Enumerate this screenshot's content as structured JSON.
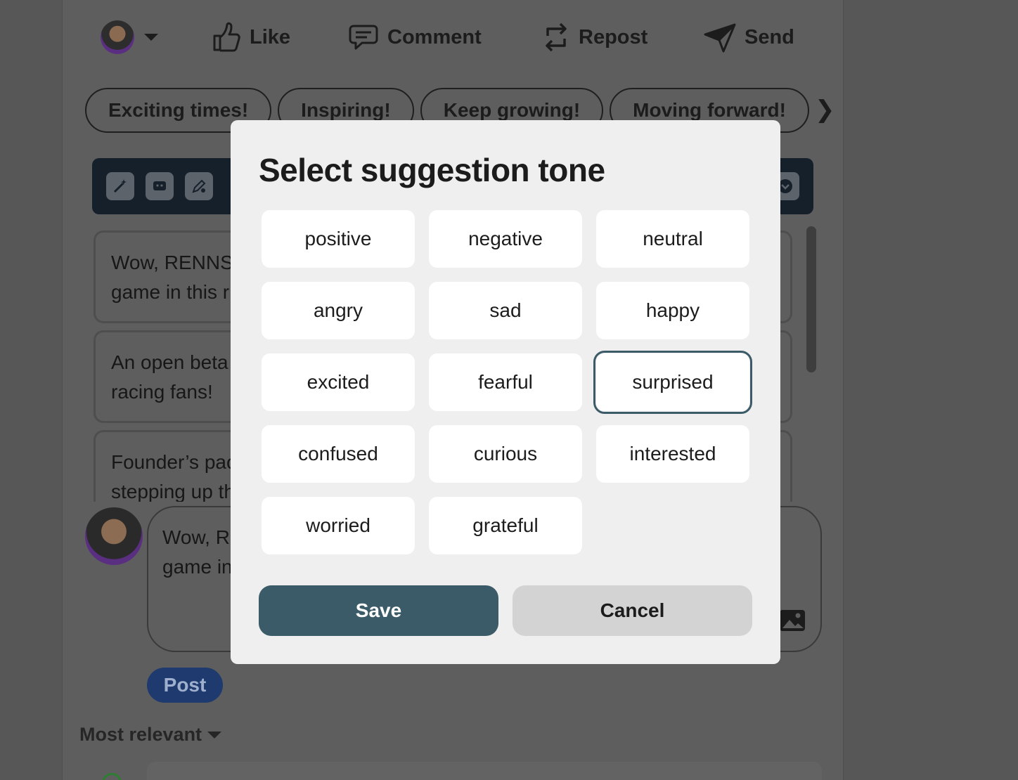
{
  "actions": {
    "like": "Like",
    "comment": "Comment",
    "repost": "Repost",
    "send": "Send"
  },
  "chips": [
    "Exciting times!",
    "Inspiring!",
    "Keep growing!",
    "Moving forward!"
  ],
  "chip_next_icon": "chevron-right-icon",
  "toolbar_icons": [
    "magic-wand-icon",
    "chat-bubble-icon",
    "pencil-settings-icon",
    "chevron-down-icon"
  ],
  "suggestions": [
    {
      "line1": "Wow, RENNSI",
      "line2": "game in this r"
    },
    {
      "line1": "An open beta",
      "line2": "racing fans!"
    },
    {
      "line1": "Founder’s pac",
      "line2": "stepping up th"
    }
  ],
  "comment_box": {
    "line1": "Wow, RI",
    "line2": "game in"
  },
  "post_button": "Post",
  "sort_label": "Most relevant",
  "modal": {
    "title": "Select suggestion tone",
    "tones": [
      "positive",
      "negative",
      "neutral",
      "angry",
      "sad",
      "happy",
      "excited",
      "fearful",
      "surprised",
      "confused",
      "curious",
      "interested",
      "worried",
      "grateful"
    ],
    "selected": "surprised",
    "save_label": "Save",
    "cancel_label": "Cancel"
  },
  "colors": {
    "overlay_bg": "#575757",
    "modal_bg": "#efefef",
    "accent": "#3b5b68",
    "cancel_bg": "#d3d3d3",
    "post_button": "#1e3a6e",
    "toolbar_bg": "#16202b"
  }
}
